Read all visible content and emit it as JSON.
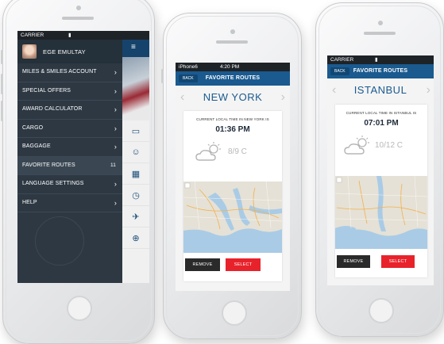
{
  "colors": {
    "accent_blue": "#1a5a8f",
    "menu_bg": "#2d3843",
    "select_red": "#e8222b",
    "remove_dark": "#2a2a2a"
  },
  "phone1": {
    "status": {
      "carrier": "CARRIER"
    },
    "profile": {
      "name": "EGE EMULTAY"
    },
    "menu": [
      {
        "label": "MILES & SMILES ACCOUNT"
      },
      {
        "label": "SPECIAL OFFERS"
      },
      {
        "label": "AWARD CALCULATOR"
      },
      {
        "label": "CARGO"
      },
      {
        "label": "BAGGAGE"
      },
      {
        "label": "FAVORITE ROUTES",
        "count": "11"
      },
      {
        "label": "LANGUAGE SETTINGS"
      },
      {
        "label": "HELP"
      }
    ]
  },
  "phone2": {
    "status": {
      "carrier": "iPhone6",
      "time": "4:20 PM"
    },
    "nav": {
      "back": "BACK",
      "title": "FAVORITE ROUTES"
    },
    "city": "NEW YORK",
    "label": "CURRENT LOCAL TIME IN NEW YORK IS",
    "time": "01:36 PM",
    "temp": "8/9 C",
    "buttons": {
      "remove": "REMOVE",
      "select": "SELECT"
    }
  },
  "phone3": {
    "status": {
      "carrier": "CARRIER"
    },
    "nav": {
      "back": "BACK",
      "title": "FAVORITE ROUTES"
    },
    "city": "ISTANBUL",
    "label": "CURRENT LOCAL TIME IN ISTANBUL IS",
    "time": "07:01 PM",
    "temp": "10/12 C",
    "buttons": {
      "remove": "REMOVE",
      "select": "SELECT"
    }
  },
  "icons": [
    "chevron-right-icon",
    "card-icon",
    "person-icon",
    "calendar-icon",
    "clock-icon",
    "plane-icon",
    "globe-icon",
    "cloud-sun-icon",
    "menu-icon"
  ]
}
